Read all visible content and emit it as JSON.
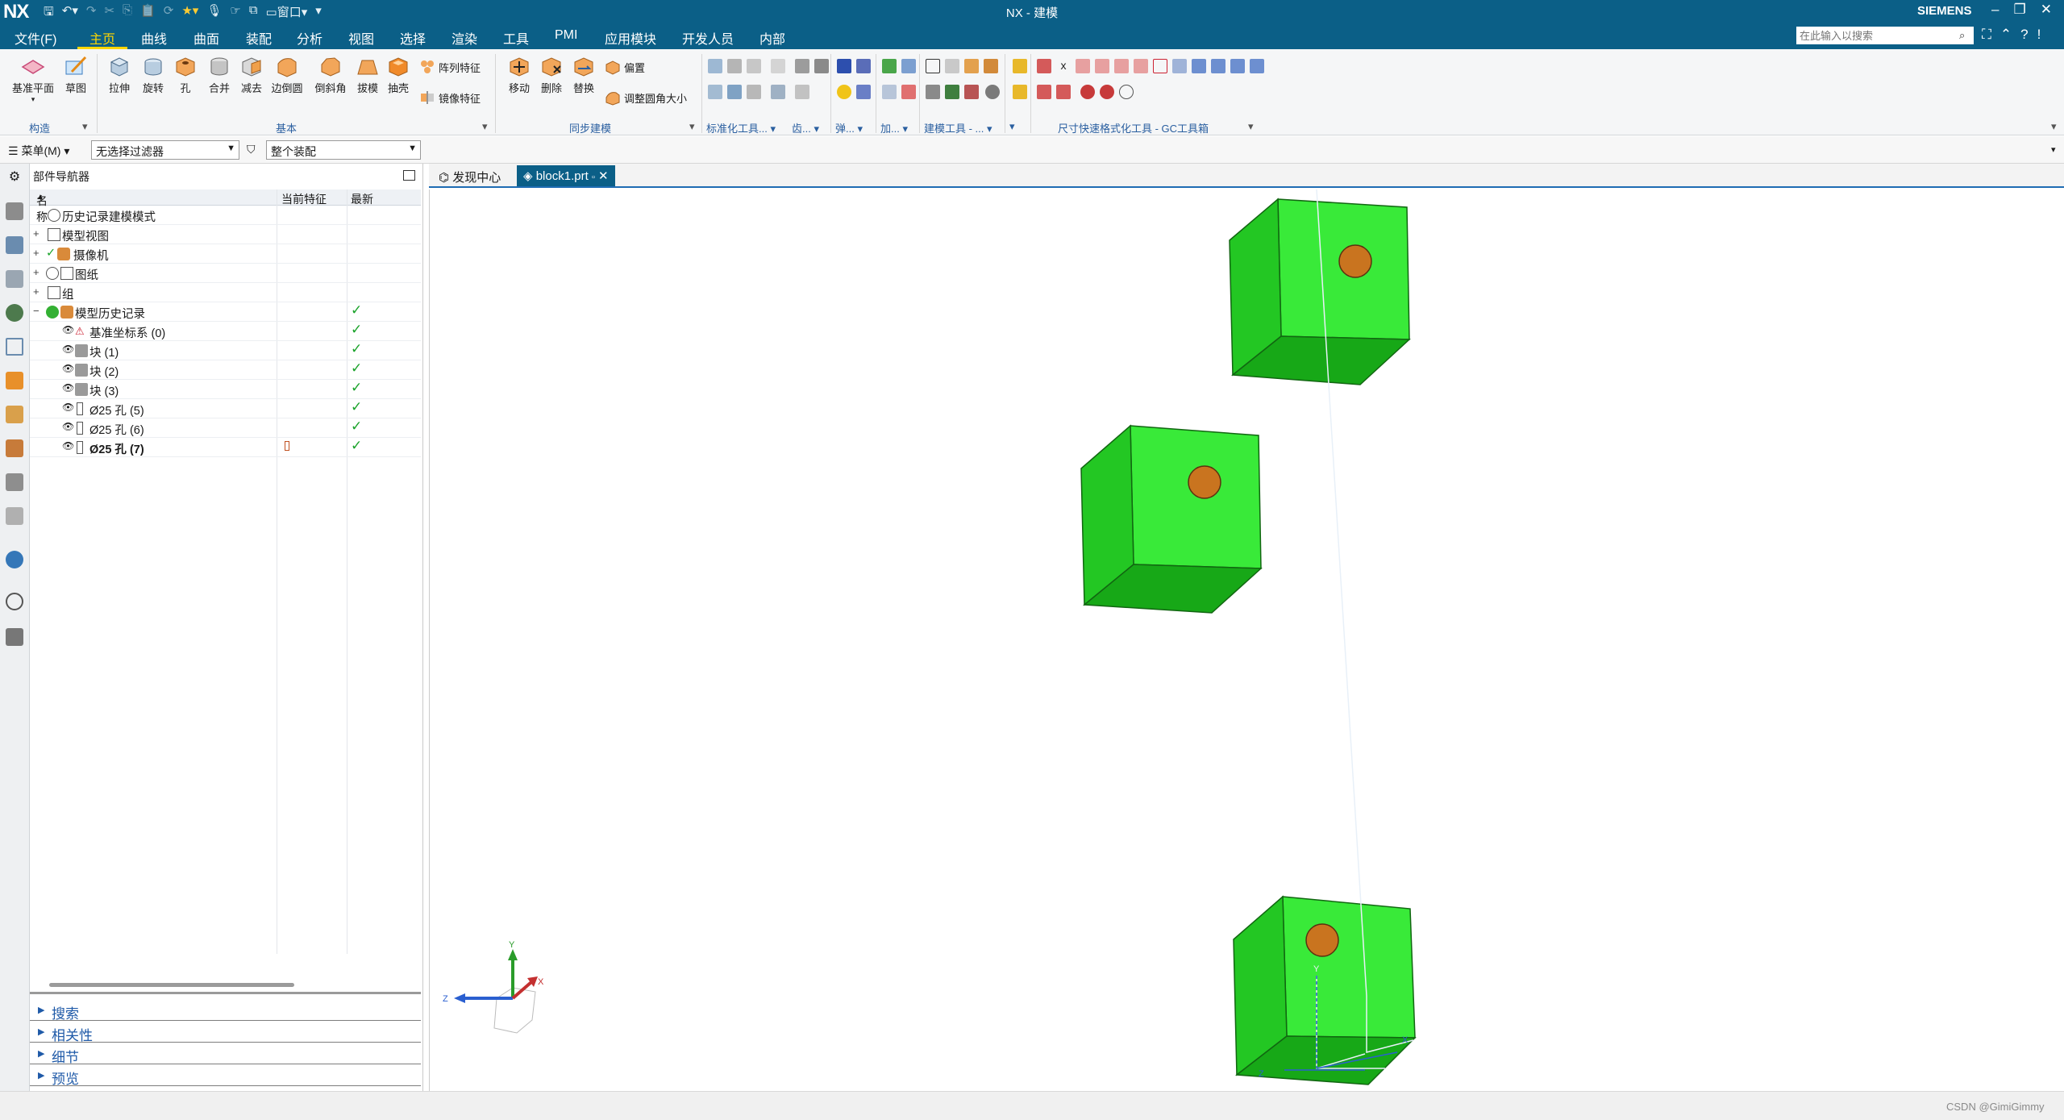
{
  "window": {
    "logo": "NX",
    "title": "NX - 建模",
    "brand": "SIEMENS",
    "quick_access": {
      "window_menu": "窗口"
    }
  },
  "menu": {
    "items": [
      "文件(F)",
      "主页",
      "曲线",
      "曲面",
      "装配",
      "分析",
      "视图",
      "选择",
      "渲染",
      "工具",
      "PMI",
      "应用模块",
      "开发人员",
      "内部"
    ],
    "active": "主页",
    "search_placeholder": "在此输入以搜索"
  },
  "ribbon": {
    "construct": {
      "datum_plane": "基准平面",
      "sketch": "草图",
      "group_label": "构造"
    },
    "basic": {
      "extrude": "拉伸",
      "revolve": "旋转",
      "hole": "孔",
      "unite": "合并",
      "subtract": "减去",
      "edge_blend": "边倒圆",
      "chamfer": "倒斜角",
      "draft": "拔模",
      "shell": "抽壳",
      "pattern_feature": "阵列特征",
      "mirror_feature": "镜像特征",
      "group_label": "基本"
    },
    "sync": {
      "move": "移动",
      "delete": "删除",
      "replace": "替换",
      "offset": "偏置",
      "resize_blend": "调整圆角大小",
      "group_label": "同步建模"
    },
    "groups_right": {
      "standard_tools": "标准化工具...",
      "gear": "齿...",
      "spring": "弹...",
      "add": "加...",
      "modeling_tools": "建模工具 - ...",
      "misc": "",
      "dim_quick": "尺寸快速格式化工具 - GC工具箱"
    }
  },
  "filterbar": {
    "menu_label": "菜单(M)",
    "selection_filter": "无选择过滤器",
    "assembly_scope": "整个装配"
  },
  "navigator": {
    "title": "部件导航器",
    "columns": {
      "name": "名称",
      "current_feature": "当前特征",
      "latest": "最新"
    },
    "rows": [
      {
        "label": "历史记录建模模式",
        "expander": "",
        "latest": ""
      },
      {
        "label": "模型视图",
        "expander": "+",
        "latest": ""
      },
      {
        "label": "摄像机",
        "expander": "+",
        "latest": ""
      },
      {
        "label": "图纸",
        "expander": "+",
        "latest": ""
      },
      {
        "label": "组",
        "expander": "+",
        "latest": ""
      },
      {
        "label": "模型历史记录",
        "expander": "−",
        "latest": "✓"
      },
      {
        "label": "基准坐标系 (0)",
        "expander": "",
        "latest": "✓"
      },
      {
        "label": "块 (1)",
        "expander": "",
        "latest": "✓"
      },
      {
        "label": "块 (2)",
        "expander": "",
        "latest": "✓"
      },
      {
        "label": "块 (3)",
        "expander": "",
        "latest": "✓"
      },
      {
        "label": "Ø25 孔 (5)",
        "expander": "",
        "latest": "✓"
      },
      {
        "label": "Ø25 孔 (6)",
        "expander": "",
        "latest": "✓"
      },
      {
        "label": "Ø25 孔 (7)",
        "expander": "",
        "latest": "✓"
      }
    ],
    "sections": [
      "搜索",
      "相关性",
      "细节",
      "预览"
    ]
  },
  "tabs": {
    "discovery": "发现中心",
    "part": "block1.prt"
  },
  "graphics": {
    "triad": {
      "x": "X",
      "y": "Y",
      "z": "Z"
    },
    "block_color": "#33e033",
    "hole_color": "#c9741f"
  },
  "watermark": "CSDN @GimiGimmy"
}
